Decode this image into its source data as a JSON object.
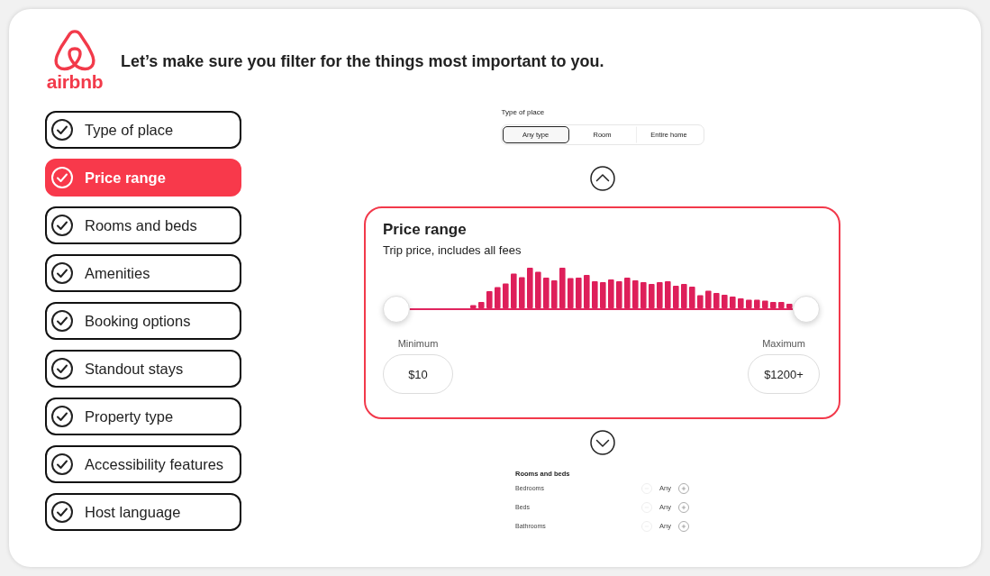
{
  "logo": {
    "wordmark": "airbnb"
  },
  "heading": "Let’s make sure you filter for the things most important to you.",
  "nav": [
    {
      "label": "Type of place",
      "selected": false,
      "checked": true
    },
    {
      "label": "Price range",
      "selected": true,
      "checked": true
    },
    {
      "label": "Rooms and beds",
      "selected": false,
      "checked": true
    },
    {
      "label": "Amenities",
      "selected": false,
      "checked": true
    },
    {
      "label": "Booking options",
      "selected": false,
      "checked": true
    },
    {
      "label": "Standout stays",
      "selected": false,
      "checked": true
    },
    {
      "label": "Property type",
      "selected": false,
      "checked": true
    },
    {
      "label": "Accessibility features",
      "selected": false,
      "checked": true
    },
    {
      "label": "Host language",
      "selected": false,
      "checked": true
    }
  ],
  "type_of_place": {
    "title": "Type of place",
    "options": [
      {
        "label": "Any type",
        "selected": true
      },
      {
        "label": "Room",
        "selected": false
      },
      {
        "label": "Entire home",
        "selected": false
      }
    ]
  },
  "price_range": {
    "title": "Price range",
    "subtitle": "Trip price, includes all fees",
    "handles": [
      {
        "level": 0
      },
      {
        "level": 1
      }
    ],
    "minimum": {
      "label": "Minimum",
      "value": "$10"
    },
    "maximum": {
      "label": "Maximum",
      "value": "$1200+"
    }
  },
  "rooms_and_beds": {
    "title": "Rooms and beds",
    "rows": [
      {
        "label": "Bedrooms",
        "value": "Any",
        "decrease_disabled": true
      },
      {
        "label": "Beds",
        "value": "Any",
        "decrease_disabled": true
      },
      {
        "label": "Bathrooms",
        "value": "Any",
        "decrease_disabled": true
      }
    ]
  }
}
